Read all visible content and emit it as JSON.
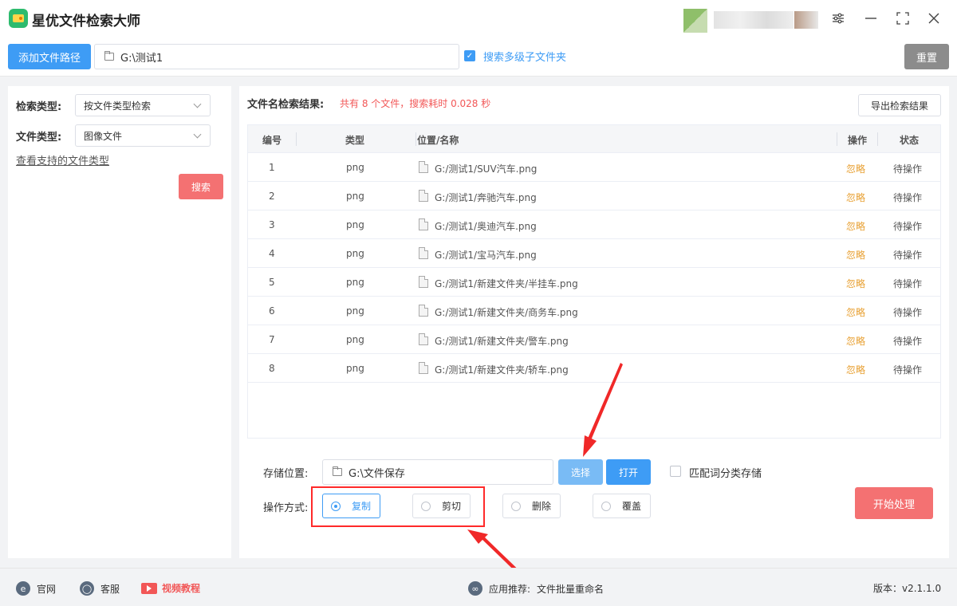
{
  "app": {
    "title": "星优文件检索大师"
  },
  "toolbar": {
    "add_path_label": "添加文件路径",
    "path_value": "G:\\测试1",
    "subfolder_label": "搜索多级子文件夹",
    "subfolder_checked": true,
    "reset_label": "重置"
  },
  "left": {
    "search_type_label": "检索类型:",
    "search_type_value": "按文件类型检索",
    "file_type_label": "文件类型:",
    "file_type_value": "图像文件",
    "supported_link": "查看支持的文件类型",
    "search_button": "搜索"
  },
  "results": {
    "title": "文件名检索结果:",
    "summary": "共有 8 个文件，搜索耗时 0.028 秒",
    "export_button": "导出检索结果",
    "columns": [
      "编号",
      "类型",
      "位置/名称",
      "操作",
      "状态"
    ],
    "rows": [
      {
        "no": "1",
        "type": "png",
        "path": "G:/测试1/SUV汽车.png",
        "op": "忽略",
        "status": "待操作"
      },
      {
        "no": "2",
        "type": "png",
        "path": "G:/测试1/奔驰汽车.png",
        "op": "忽略",
        "status": "待操作"
      },
      {
        "no": "3",
        "type": "png",
        "path": "G:/测试1/奥迪汽车.png",
        "op": "忽略",
        "status": "待操作"
      },
      {
        "no": "4",
        "type": "png",
        "path": "G:/测试1/宝马汽车.png",
        "op": "忽略",
        "status": "待操作"
      },
      {
        "no": "5",
        "type": "png",
        "path": "G:/测试1/新建文件夹/半挂车.png",
        "op": "忽略",
        "status": "待操作"
      },
      {
        "no": "6",
        "type": "png",
        "path": "G:/测试1/新建文件夹/商务车.png",
        "op": "忽略",
        "status": "待操作"
      },
      {
        "no": "7",
        "type": "png",
        "path": "G:/测试1/新建文件夹/警车.png",
        "op": "忽略",
        "status": "待操作"
      },
      {
        "no": "8",
        "type": "png",
        "path": "G:/测试1/新建文件夹/轿车.png",
        "op": "忽略",
        "status": "待操作"
      }
    ]
  },
  "storage": {
    "label": "存储位置:",
    "value": "G:\\文件保存",
    "choose_button": "选择",
    "open_button": "打开",
    "match_label": "匹配词分类存储",
    "match_checked": false
  },
  "operation": {
    "label": "操作方式:",
    "options": [
      "复制",
      "剪切",
      "删除",
      "覆盖"
    ],
    "selected": "复制",
    "start_button": "开始处理"
  },
  "footer": {
    "website": "官网",
    "support": "客服",
    "video": "视频教程",
    "recommend_label": "应用推荐:",
    "recommend_app": "文件批量重命名",
    "version": "版本：v2.1.1.0"
  },
  "colors": {
    "primary": "#3e9cf5",
    "danger": "#f47172",
    "warning": "#e8a032",
    "highlight": "#ff2a2a"
  }
}
